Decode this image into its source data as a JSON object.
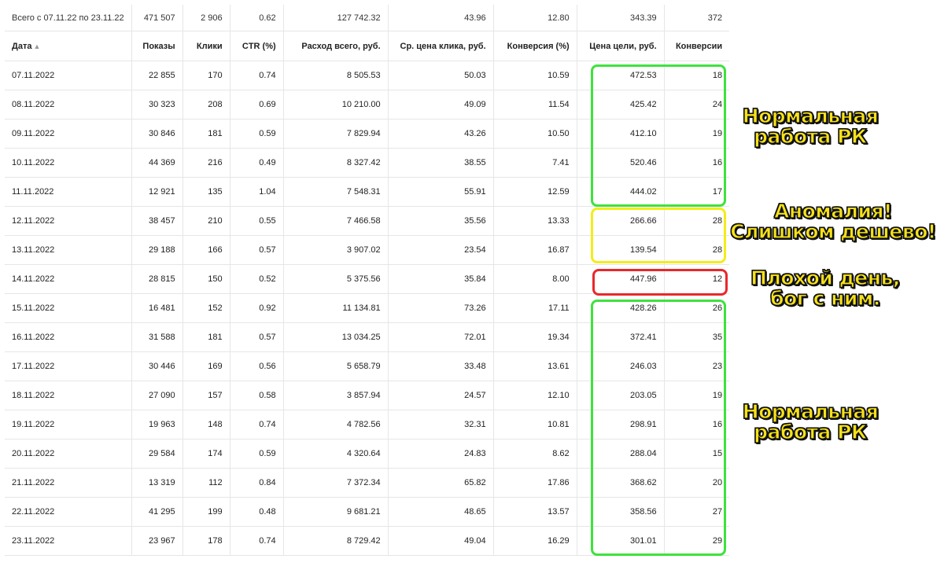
{
  "totals": {
    "label": "Всего с 07.11.22 по 23.11.22",
    "values": [
      "471 507",
      "2 906",
      "0.62",
      "127 742.32",
      "43.96",
      "12.80",
      "343.39",
      "372"
    ]
  },
  "headers": {
    "date": "Дата",
    "sort_indicator": "▲",
    "columns": [
      "Показы",
      "Клики",
      "CTR (%)",
      "Расход всего, руб.",
      "Ср. цена клика, руб.",
      "Конверсия (%)",
      "Цена цели, руб.",
      "Конверсии"
    ]
  },
  "rows": [
    [
      "07.11.2022",
      "22 855",
      "170",
      "0.74",
      "8 505.53",
      "50.03",
      "10.59",
      "472.53",
      "18"
    ],
    [
      "08.11.2022",
      "30 323",
      "208",
      "0.69",
      "10 210.00",
      "49.09",
      "11.54",
      "425.42",
      "24"
    ],
    [
      "09.11.2022",
      "30 846",
      "181",
      "0.59",
      "7 829.94",
      "43.26",
      "10.50",
      "412.10",
      "19"
    ],
    [
      "10.11.2022",
      "44 369",
      "216",
      "0.49",
      "8 327.42",
      "38.55",
      "7.41",
      "520.46",
      "16"
    ],
    [
      "11.11.2022",
      "12 921",
      "135",
      "1.04",
      "7 548.31",
      "55.91",
      "12.59",
      "444.02",
      "17"
    ],
    [
      "12.11.2022",
      "38 457",
      "210",
      "0.55",
      "7 466.58",
      "35.56",
      "13.33",
      "266.66",
      "28"
    ],
    [
      "13.11.2022",
      "29 188",
      "166",
      "0.57",
      "3 907.02",
      "23.54",
      "16.87",
      "139.54",
      "28"
    ],
    [
      "14.11.2022",
      "28 815",
      "150",
      "0.52",
      "5 375.56",
      "35.84",
      "8.00",
      "447.96",
      "12"
    ],
    [
      "15.11.2022",
      "16 481",
      "152",
      "0.92",
      "11 134.81",
      "73.26",
      "17.11",
      "428.26",
      "26"
    ],
    [
      "16.11.2022",
      "31 588",
      "181",
      "0.57",
      "13 034.25",
      "72.01",
      "19.34",
      "372.41",
      "35"
    ],
    [
      "17.11.2022",
      "30 446",
      "169",
      "0.56",
      "5 658.79",
      "33.48",
      "13.61",
      "246.03",
      "23"
    ],
    [
      "18.11.2022",
      "27 090",
      "157",
      "0.58",
      "3 857.94",
      "24.57",
      "12.10",
      "203.05",
      "19"
    ],
    [
      "19.11.2022",
      "19 963",
      "148",
      "0.74",
      "4 782.56",
      "32.31",
      "10.81",
      "298.91",
      "16"
    ],
    [
      "20.11.2022",
      "29 584",
      "174",
      "0.59",
      "4 320.64",
      "24.83",
      "8.62",
      "288.04",
      "15"
    ],
    [
      "21.11.2022",
      "13 319",
      "112",
      "0.84",
      "7 372.34",
      "65.82",
      "17.86",
      "368.62",
      "20"
    ],
    [
      "22.11.2022",
      "41 295",
      "199",
      "0.48",
      "9 681.21",
      "48.65",
      "13.57",
      "358.56",
      "27"
    ],
    [
      "23.11.2022",
      "23 967",
      "178",
      "0.74",
      "8 729.42",
      "49.04",
      "16.29",
      "301.01",
      "29"
    ]
  ],
  "annotations": {
    "normal_top": [
      "Нормальная",
      "работа РК"
    ],
    "anomaly": [
      "Аномалия!",
      "Слишком дешево!"
    ],
    "bad_day": [
      "Плохой день,",
      "бог с ним."
    ],
    "normal_bottom": [
      "Нормальная",
      "работа РК"
    ]
  },
  "colors": {
    "normal_box": "#3ee23e",
    "anomaly_box": "#f3ec1c",
    "bad_box": "#e8282c",
    "note_text": "#f7e217"
  }
}
